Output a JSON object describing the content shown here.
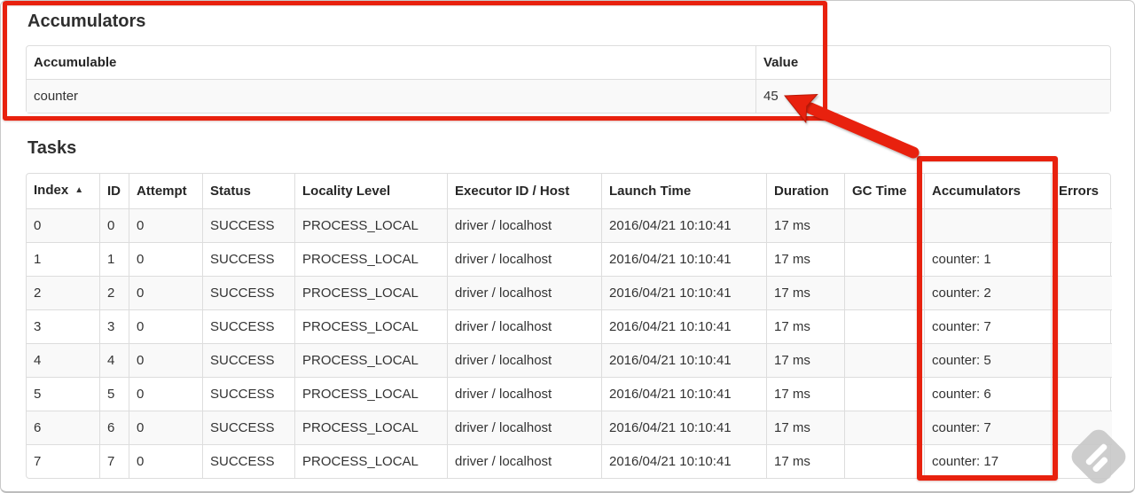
{
  "colors": {
    "annotation_red": "#e8210e",
    "annotation_red_dark": "#b81806",
    "table_border": "#dddddd",
    "row_stripe": "#f9f9f9",
    "text": "#333333",
    "watermark_gray": "#c9c9c9"
  },
  "accumulators": {
    "heading": "Accumulators",
    "headers": [
      "Accumulable",
      "Value"
    ],
    "rows": [
      [
        "counter",
        "45"
      ]
    ]
  },
  "tasks": {
    "heading": "Tasks",
    "sort_icon": "▲",
    "column_keys": [
      "index",
      "id",
      "attempt",
      "status",
      "locality-level",
      "executor-id-host",
      "launch-time",
      "duration",
      "gc-time",
      "accumulators",
      "errors"
    ],
    "headers": [
      "Index",
      "ID",
      "Attempt",
      "Status",
      "Locality Level",
      "Executor ID / Host",
      "Launch Time",
      "Duration",
      "GC Time",
      "Accumulators",
      "Errors"
    ],
    "rows": [
      [
        "0",
        "0",
        "0",
        "SUCCESS",
        "PROCESS_LOCAL",
        "driver / localhost",
        "2016/04/21 10:10:41",
        "17 ms",
        "",
        "",
        ""
      ],
      [
        "1",
        "1",
        "0",
        "SUCCESS",
        "PROCESS_LOCAL",
        "driver / localhost",
        "2016/04/21 10:10:41",
        "17 ms",
        "",
        "counter: 1",
        ""
      ],
      [
        "2",
        "2",
        "0",
        "SUCCESS",
        "PROCESS_LOCAL",
        "driver / localhost",
        "2016/04/21 10:10:41",
        "17 ms",
        "",
        "counter: 2",
        ""
      ],
      [
        "3",
        "3",
        "0",
        "SUCCESS",
        "PROCESS_LOCAL",
        "driver / localhost",
        "2016/04/21 10:10:41",
        "17 ms",
        "",
        "counter: 7",
        ""
      ],
      [
        "4",
        "4",
        "0",
        "SUCCESS",
        "PROCESS_LOCAL",
        "driver / localhost",
        "2016/04/21 10:10:41",
        "17 ms",
        "",
        "counter: 5",
        ""
      ],
      [
        "5",
        "5",
        "0",
        "SUCCESS",
        "PROCESS_LOCAL",
        "driver / localhost",
        "2016/04/21 10:10:41",
        "17 ms",
        "",
        "counter: 6",
        ""
      ],
      [
        "6",
        "6",
        "0",
        "SUCCESS",
        "PROCESS_LOCAL",
        "driver / localhost",
        "2016/04/21 10:10:41",
        "17 ms",
        "",
        "counter: 7",
        ""
      ],
      [
        "7",
        "7",
        "0",
        "SUCCESS",
        "PROCESS_LOCAL",
        "driver / localhost",
        "2016/04/21 10:10:41",
        "17 ms",
        "",
        "counter: 17",
        ""
      ]
    ]
  }
}
